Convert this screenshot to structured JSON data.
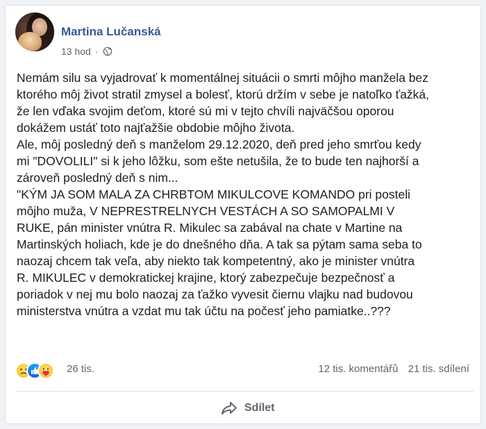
{
  "post": {
    "author": "Martina Lučanská",
    "time": "13 hod",
    "separator": "·",
    "privacy_icon": "globe-icon",
    "lines": [
      "Nemám silu sa vyjadrovať k momentálnej situácii o smrti môjho manžela bez",
      "ktorého môj život stratil zmysel a bolesť, ktorú držím v sebe je natoľko ťažká,",
      "že len vďaka svojim deťom, ktoré sú mi v tejto chvíli najväčšou oporou",
      "dokážem ustáť toto najťažšie obdobie môjho života.",
      "Ale, môj posledný deň s manželom 29.12.2020, deň pred jeho smrťou kedy",
      "mi \"DOVOLILI\" si k jeho lôžku, som ešte netušila, že to bude ten najhorší a",
      "zároveň posledný deň s nim...",
      "\"KÝM JA SOM MALA ZA CHRBTOM MIKULCOVE KOMANDO pri posteli",
      "môjho muža, V NEPRESTRELNYCH VESTÁCH A SO SAMOPALMI V",
      "RUKE, pán minister vnútra R. Mikulec sa zabával na chate v Martine na",
      "Martinských holiach, kde je do dnešného dňa. A tak sa pýtam sama seba to",
      "naozaj chcem tak veľa, aby niekto tak kompetentný, ako je minister vnútra",
      "R. MIKULEC v demokratickej krajine, ktorý zabezpečuje bezpečnosť a",
      "poriadok v nej mu bolo naozaj za ťažko vyvesit čiernu vlajku nad budovou",
      "ministerstva vnútra a vzdat mu tak účtu na počesť jeho pamiatke..???"
    ]
  },
  "stats": {
    "reaction_icons": [
      "sad-reaction-icon",
      "like-reaction-icon",
      "care-reaction-icon"
    ],
    "reactions": "26 tis.",
    "comments": "12 tis. komentářů",
    "shares": "21 tis. sdílení"
  },
  "actions": {
    "share_label": "Sdílet",
    "share_icon": "share-arrow-icon"
  },
  "colors": {
    "author": "#385898",
    "text": "#1c1e21",
    "meta": "#606770",
    "background": "#f0f2f5"
  }
}
